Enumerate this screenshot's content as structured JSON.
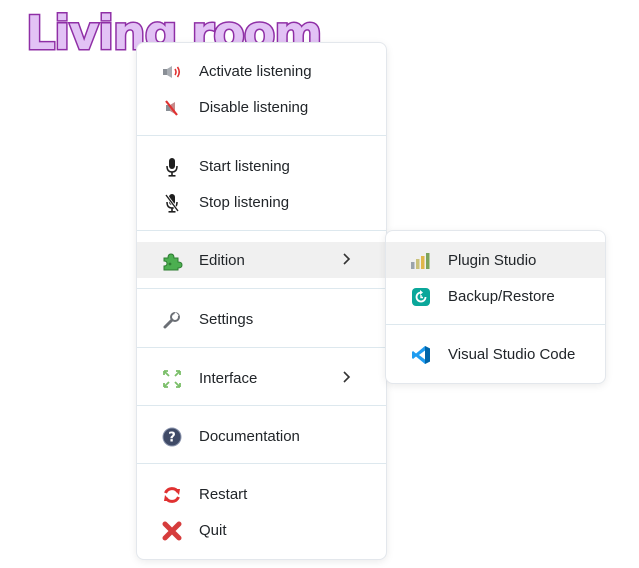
{
  "title": "Living room",
  "menu": {
    "items": [
      {
        "label": "Activate listening",
        "icon": "speaker-on-icon"
      },
      {
        "label": "Disable listening",
        "icon": "speaker-muted-icon"
      },
      {
        "label": "Start listening",
        "icon": "microphone-icon"
      },
      {
        "label": "Stop listening",
        "icon": "microphone-off-icon"
      },
      {
        "label": "Edition",
        "icon": "puzzle-icon"
      },
      {
        "label": "Settings",
        "icon": "wrench-icon"
      },
      {
        "label": "Interface",
        "icon": "expand-arrows-icon"
      },
      {
        "label": "Documentation",
        "icon": "help-icon"
      },
      {
        "label": "Restart",
        "icon": "restart-icon"
      },
      {
        "label": "Quit",
        "icon": "close-icon"
      }
    ]
  },
  "submenu": {
    "items": [
      {
        "label": "Plugin Studio",
        "icon": "bar-chart-icon"
      },
      {
        "label": "Backup/Restore",
        "icon": "backup-restore-icon"
      },
      {
        "label": "Visual Studio Code",
        "icon": "vscode-icon"
      }
    ]
  },
  "colors": {
    "title_fill": "#e2c2f5",
    "title_stroke": "#8f2fa6",
    "hover_background": "#f0f0f0",
    "separator": "#dde8ee",
    "text": "#212529"
  }
}
